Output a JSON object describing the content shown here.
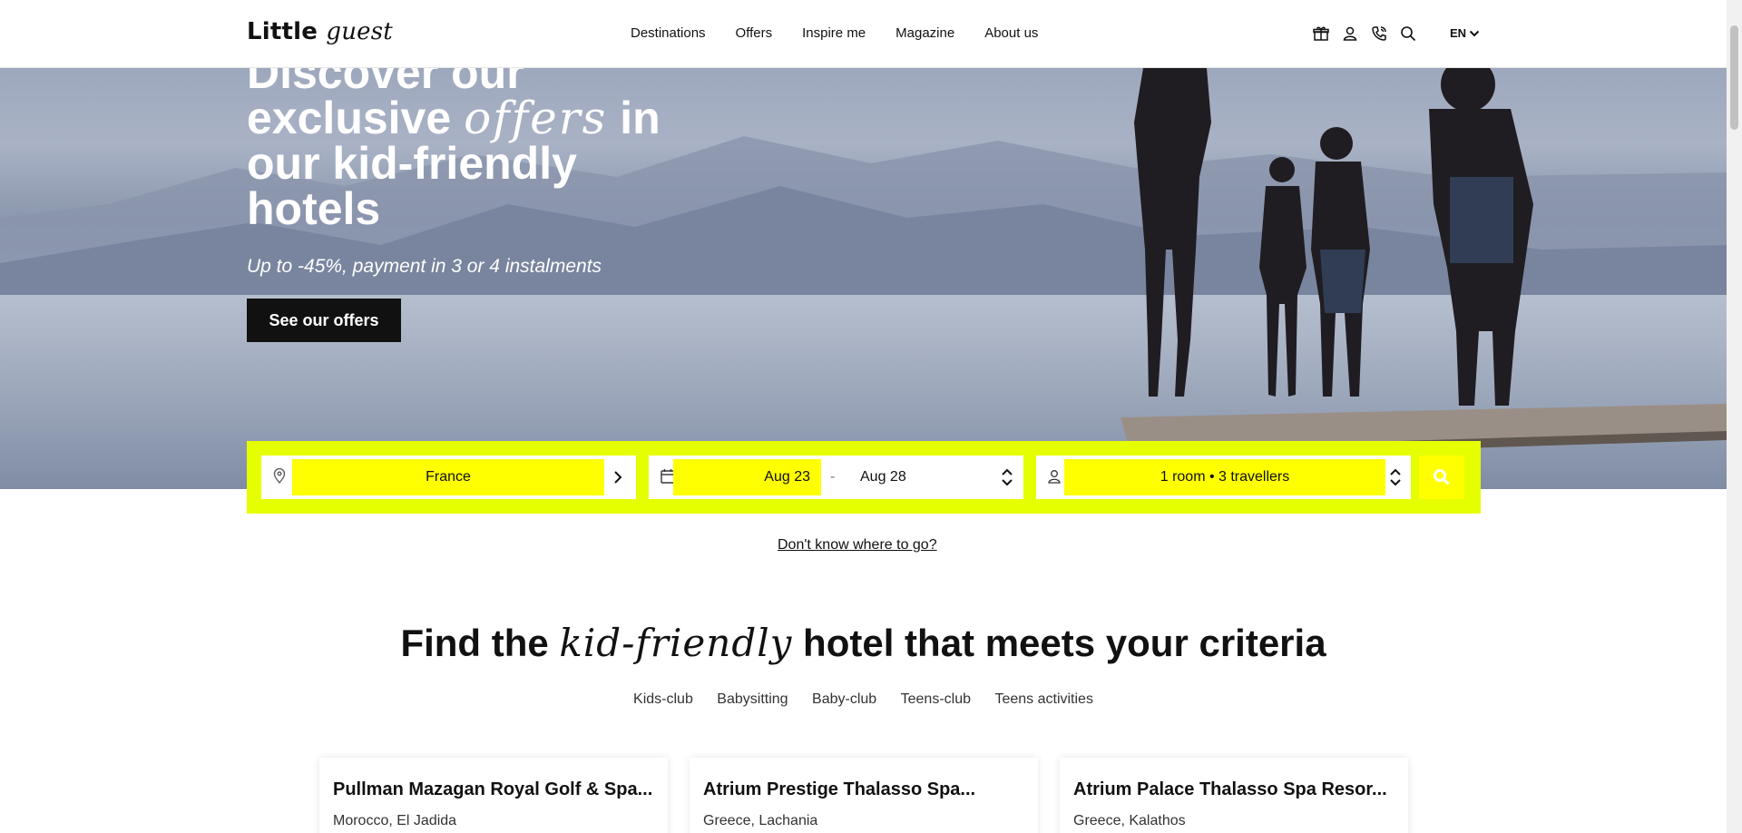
{
  "header": {
    "logo": {
      "part1": "Little",
      "part2": "guest"
    },
    "nav": [
      "Destinations",
      "Offers",
      "Inspire me",
      "Magazine",
      "About us"
    ],
    "icons": [
      "gift-icon",
      "user-icon",
      "phone-icon",
      "search-icon"
    ],
    "lang": "EN"
  },
  "hero": {
    "title_line0": "Discover our",
    "title_pre": "exclusive ",
    "title_script": "offers",
    "title_post": " in",
    "title_line2": "our kid-friendly",
    "title_line3": "hotels",
    "subtitle": "Up to -45%, payment in 3 or 4 instalments",
    "cta": "See our offers"
  },
  "search": {
    "destination": "France",
    "date_from": "Aug 23",
    "date_sep": "-",
    "date_to": "Aug 28",
    "travellers": "1 room • 3 travellers",
    "accent": "#e6ff00",
    "highlight": "#ffff00"
  },
  "dont_know": "Don't know where to go?",
  "section": {
    "title_pre": "Find the ",
    "title_script": "kid-friendly",
    "title_post": " hotel that meets your criteria",
    "filters": [
      "Kids-club",
      "Babysitting",
      "Baby-club",
      "Teens-club",
      "Teens activities"
    ]
  },
  "hotels": [
    {
      "name": "Pullman Mazagan Royal Golf & Spa...",
      "location": "Morocco, El Jadida"
    },
    {
      "name": "Atrium Prestige Thalasso Spa...",
      "location": "Greece, Lachania"
    },
    {
      "name": "Atrium Palace Thalasso Spa Resor...",
      "location": "Greece, Kalathos"
    }
  ]
}
